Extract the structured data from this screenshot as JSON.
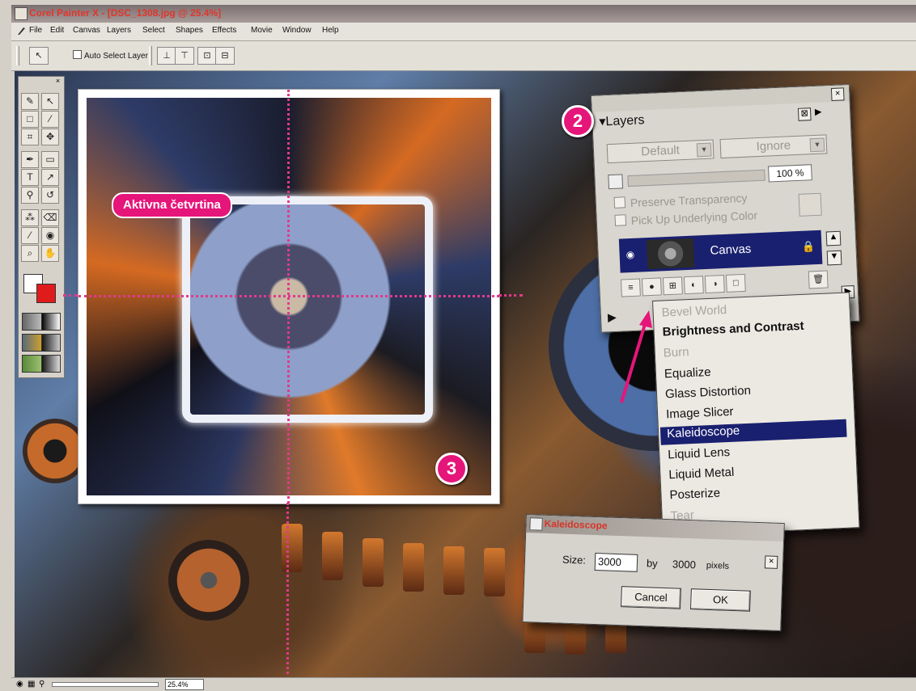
{
  "window": {
    "title": "Corel Painter X - [DSC_1308.jpg @ 25.4%]"
  },
  "menu": [
    "File",
    "Edit",
    "Canvas",
    "Layers",
    "Select",
    "Shapes",
    "Effects",
    "Movie",
    "Window",
    "Help"
  ],
  "property_bar": {
    "auto_select_label": "Auto Select Layer"
  },
  "annotations": {
    "active_quadrant_label": "Aktivna četvrtina",
    "badge_2": "2",
    "badge_3": "3"
  },
  "layers_panel": {
    "title": "Layers",
    "composite_method": "Default",
    "composite_depth": "Ignore",
    "opacity": "100 %",
    "preserve_transparency": "Preserve Transparency",
    "pick_up_color": "Pick Up Underlying Color",
    "layer_name": "Canvas"
  },
  "effects_menu": {
    "items": [
      {
        "label": "Bevel World",
        "state": "disabled"
      },
      {
        "label": "Brightness and Contrast",
        "state": "enabled"
      },
      {
        "label": "Burn",
        "state": "disabled"
      },
      {
        "label": "Equalize",
        "state": "enabled"
      },
      {
        "label": "Glass Distortion",
        "state": "enabled"
      },
      {
        "label": "Image Slicer",
        "state": "enabled"
      },
      {
        "label": "Kaleidoscope",
        "state": "selected"
      },
      {
        "label": "Liquid Lens",
        "state": "enabled"
      },
      {
        "label": "Liquid Metal",
        "state": "enabled"
      },
      {
        "label": "Posterize",
        "state": "enabled"
      },
      {
        "label": "Tear",
        "state": "disabled"
      }
    ]
  },
  "kaleidoscope_dialog": {
    "title": "Kaleidoscope",
    "size_label": "Size:",
    "size_value": "3000",
    "by_label": "by",
    "height_value": "3000",
    "unit": "pixels",
    "cancel": "Cancel",
    "ok": "OK"
  },
  "status": {
    "zoom": "25.4%"
  },
  "colors": {
    "accent": "#e6157a",
    "selection": "#1a2070",
    "primary_color": "#ffffff",
    "secondary_color": "#e01b1b"
  }
}
